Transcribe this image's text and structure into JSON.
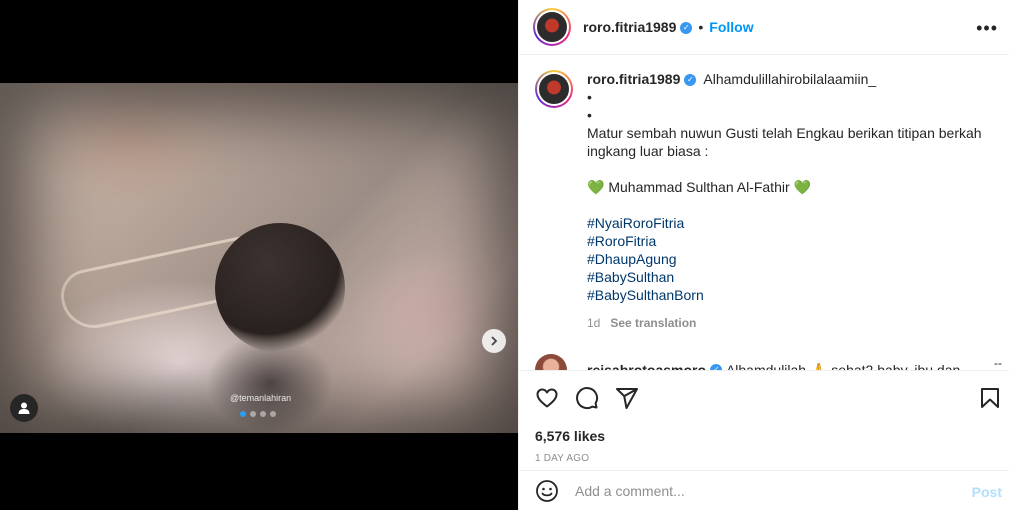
{
  "post": {
    "username": "roro.fitria1989",
    "follow_label": "Follow",
    "more_label": "•••",
    "image_watermark": "@temanlahiran",
    "carousel_count": 4,
    "carousel_active": 1
  },
  "caption": {
    "first_line": "Alhamdulillahirobilalaamiin_",
    "dot1": "•",
    "dot2": "•",
    "line1": "Matur sembah nuwun Gusti telah Engkau berikan titipan berkah",
    "line2": "ingkang luar biasa :",
    "heart_left": "💚",
    "name_line": "Muhammad Sulthan Al-Fathir",
    "heart_right": "💚",
    "hashtags": [
      "#NyaiRoroFitria",
      "#RoroFitria",
      "#DhaupAgung",
      "#BabySulthan",
      "#BabySulthanBorn"
    ],
    "age": "1d",
    "see_translation": "See translation"
  },
  "comment": {
    "username": "reisabrotoasmoro",
    "text": "Alhamdulilah 🙏 sehat2 baby, ibu dan",
    "more": "--"
  },
  "stats": {
    "likes": "6,576 likes",
    "timestamp": "1 DAY AGO"
  },
  "composer": {
    "placeholder": "Add a comment...",
    "post_label": "Post"
  },
  "colors": {
    "accent": "#0095f6",
    "hashtag": "#00376b",
    "muted": "#8e8e8e",
    "post_disabled": "#b2dffc"
  }
}
